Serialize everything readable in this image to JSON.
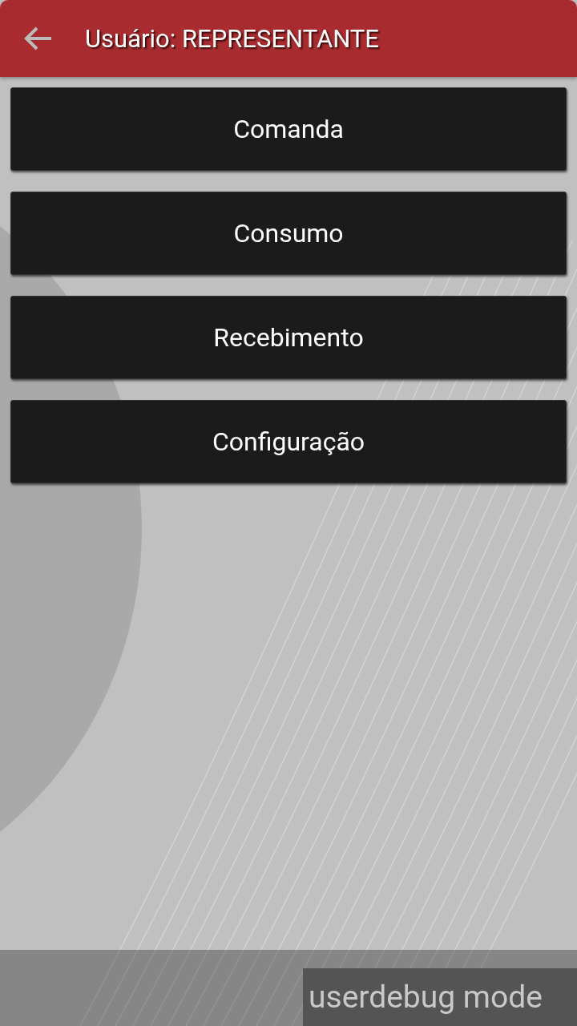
{
  "app_bar": {
    "title": "Usuário: REPRESENTANTE"
  },
  "menu": [
    {
      "label": "Comanda"
    },
    {
      "label": "Consumo"
    },
    {
      "label": "Recebimento"
    },
    {
      "label": "Configuração"
    }
  ],
  "debug_label": "userdebug mode"
}
